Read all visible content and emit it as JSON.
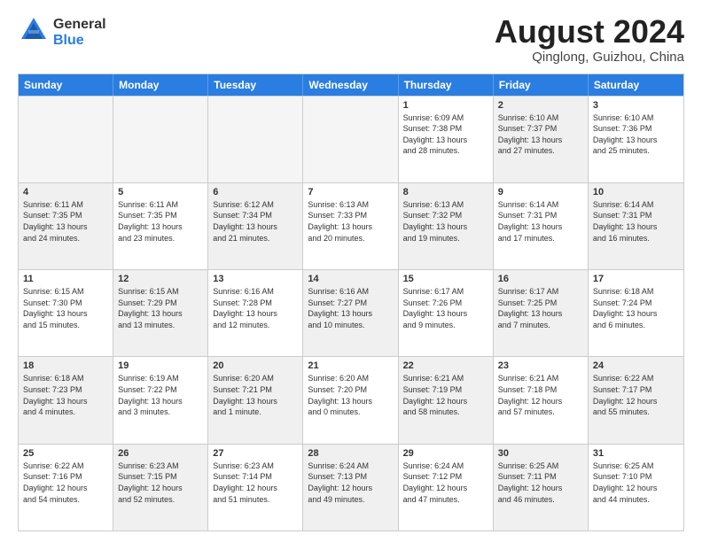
{
  "header": {
    "logo_line1": "General",
    "logo_line2": "Blue",
    "title": "August 2024",
    "subtitle": "Qinglong, Guizhou, China"
  },
  "days_of_week": [
    "Sunday",
    "Monday",
    "Tuesday",
    "Wednesday",
    "Thursday",
    "Friday",
    "Saturday"
  ],
  "weeks": [
    [
      {
        "day": "",
        "info": "",
        "empty": true
      },
      {
        "day": "",
        "info": "",
        "empty": true
      },
      {
        "day": "",
        "info": "",
        "empty": true
      },
      {
        "day": "",
        "info": "",
        "empty": true
      },
      {
        "day": "1",
        "info": "Sunrise: 6:09 AM\nSunset: 7:38 PM\nDaylight: 13 hours\nand 28 minutes.",
        "shaded": false
      },
      {
        "day": "2",
        "info": "Sunrise: 6:10 AM\nSunset: 7:37 PM\nDaylight: 13 hours\nand 27 minutes.",
        "shaded": true
      },
      {
        "day": "3",
        "info": "Sunrise: 6:10 AM\nSunset: 7:36 PM\nDaylight: 13 hours\nand 25 minutes.",
        "shaded": false
      }
    ],
    [
      {
        "day": "4",
        "info": "Sunrise: 6:11 AM\nSunset: 7:35 PM\nDaylight: 13 hours\nand 24 minutes.",
        "shaded": true
      },
      {
        "day": "5",
        "info": "Sunrise: 6:11 AM\nSunset: 7:35 PM\nDaylight: 13 hours\nand 23 minutes.",
        "shaded": false
      },
      {
        "day": "6",
        "info": "Sunrise: 6:12 AM\nSunset: 7:34 PM\nDaylight: 13 hours\nand 21 minutes.",
        "shaded": true
      },
      {
        "day": "7",
        "info": "Sunrise: 6:13 AM\nSunset: 7:33 PM\nDaylight: 13 hours\nand 20 minutes.",
        "shaded": false
      },
      {
        "day": "8",
        "info": "Sunrise: 6:13 AM\nSunset: 7:32 PM\nDaylight: 13 hours\nand 19 minutes.",
        "shaded": true
      },
      {
        "day": "9",
        "info": "Sunrise: 6:14 AM\nSunset: 7:31 PM\nDaylight: 13 hours\nand 17 minutes.",
        "shaded": false
      },
      {
        "day": "10",
        "info": "Sunrise: 6:14 AM\nSunset: 7:31 PM\nDaylight: 13 hours\nand 16 minutes.",
        "shaded": true
      }
    ],
    [
      {
        "day": "11",
        "info": "Sunrise: 6:15 AM\nSunset: 7:30 PM\nDaylight: 13 hours\nand 15 minutes.",
        "shaded": false
      },
      {
        "day": "12",
        "info": "Sunrise: 6:15 AM\nSunset: 7:29 PM\nDaylight: 13 hours\nand 13 minutes.",
        "shaded": true
      },
      {
        "day": "13",
        "info": "Sunrise: 6:16 AM\nSunset: 7:28 PM\nDaylight: 13 hours\nand 12 minutes.",
        "shaded": false
      },
      {
        "day": "14",
        "info": "Sunrise: 6:16 AM\nSunset: 7:27 PM\nDaylight: 13 hours\nand 10 minutes.",
        "shaded": true
      },
      {
        "day": "15",
        "info": "Sunrise: 6:17 AM\nSunset: 7:26 PM\nDaylight: 13 hours\nand 9 minutes.",
        "shaded": false
      },
      {
        "day": "16",
        "info": "Sunrise: 6:17 AM\nSunset: 7:25 PM\nDaylight: 13 hours\nand 7 minutes.",
        "shaded": true
      },
      {
        "day": "17",
        "info": "Sunrise: 6:18 AM\nSunset: 7:24 PM\nDaylight: 13 hours\nand 6 minutes.",
        "shaded": false
      }
    ],
    [
      {
        "day": "18",
        "info": "Sunrise: 6:18 AM\nSunset: 7:23 PM\nDaylight: 13 hours\nand 4 minutes.",
        "shaded": true
      },
      {
        "day": "19",
        "info": "Sunrise: 6:19 AM\nSunset: 7:22 PM\nDaylight: 13 hours\nand 3 minutes.",
        "shaded": false
      },
      {
        "day": "20",
        "info": "Sunrise: 6:20 AM\nSunset: 7:21 PM\nDaylight: 13 hours\nand 1 minute.",
        "shaded": true
      },
      {
        "day": "21",
        "info": "Sunrise: 6:20 AM\nSunset: 7:20 PM\nDaylight: 13 hours\nand 0 minutes.",
        "shaded": false
      },
      {
        "day": "22",
        "info": "Sunrise: 6:21 AM\nSunset: 7:19 PM\nDaylight: 12 hours\nand 58 minutes.",
        "shaded": true
      },
      {
        "day": "23",
        "info": "Sunrise: 6:21 AM\nSunset: 7:18 PM\nDaylight: 12 hours\nand 57 minutes.",
        "shaded": false
      },
      {
        "day": "24",
        "info": "Sunrise: 6:22 AM\nSunset: 7:17 PM\nDaylight: 12 hours\nand 55 minutes.",
        "shaded": true
      }
    ],
    [
      {
        "day": "25",
        "info": "Sunrise: 6:22 AM\nSunset: 7:16 PM\nDaylight: 12 hours\nand 54 minutes.",
        "shaded": false
      },
      {
        "day": "26",
        "info": "Sunrise: 6:23 AM\nSunset: 7:15 PM\nDaylight: 12 hours\nand 52 minutes.",
        "shaded": true
      },
      {
        "day": "27",
        "info": "Sunrise: 6:23 AM\nSunset: 7:14 PM\nDaylight: 12 hours\nand 51 minutes.",
        "shaded": false
      },
      {
        "day": "28",
        "info": "Sunrise: 6:24 AM\nSunset: 7:13 PM\nDaylight: 12 hours\nand 49 minutes.",
        "shaded": true
      },
      {
        "day": "29",
        "info": "Sunrise: 6:24 AM\nSunset: 7:12 PM\nDaylight: 12 hours\nand 47 minutes.",
        "shaded": false
      },
      {
        "day": "30",
        "info": "Sunrise: 6:25 AM\nSunset: 7:11 PM\nDaylight: 12 hours\nand 46 minutes.",
        "shaded": true
      },
      {
        "day": "31",
        "info": "Sunrise: 6:25 AM\nSunset: 7:10 PM\nDaylight: 12 hours\nand 44 minutes.",
        "shaded": false
      }
    ]
  ]
}
